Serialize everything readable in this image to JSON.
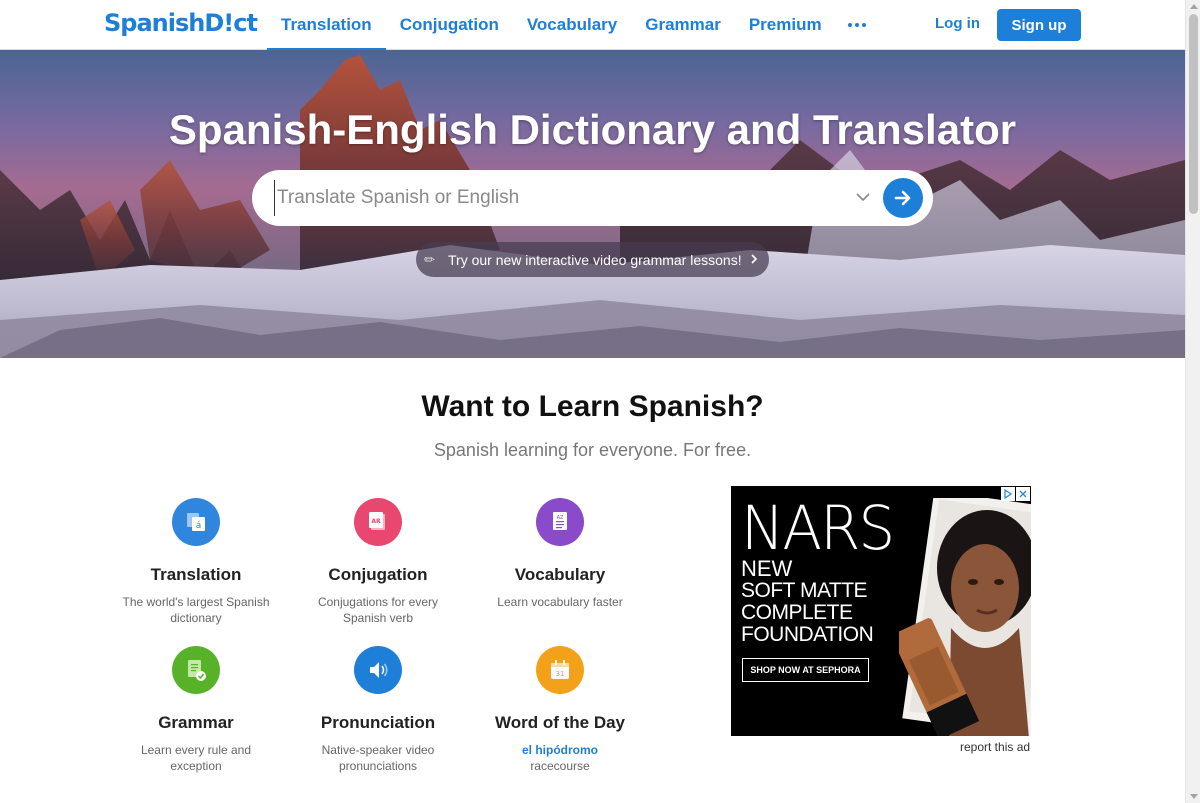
{
  "header": {
    "logo": "SpanishD!ct",
    "nav": [
      "Translation",
      "Conjugation",
      "Vocabulary",
      "Grammar",
      "Premium"
    ],
    "login": "Log in",
    "signup": "Sign up"
  },
  "hero": {
    "title": "Spanish-English Dictionary and Translator",
    "search_placeholder": "Translate Spanish or English",
    "promo": "Try our new interactive video grammar lessons!"
  },
  "learn": {
    "title": "Want to Learn Spanish?",
    "subtitle": "Spanish learning for everyone. For free.",
    "features": [
      {
        "title": "Translation",
        "desc": "The world's largest Spanish dictionary"
      },
      {
        "title": "Conjugation",
        "desc": "Conjugations for every Spanish verb"
      },
      {
        "title": "Vocabulary",
        "desc": "Learn vocabulary faster"
      },
      {
        "title": "Grammar",
        "desc": "Learn every rule and exception"
      },
      {
        "title": "Pronunciation",
        "desc": "Native-speaker video pronunciations"
      },
      {
        "title": "Word of the Day",
        "word": "el hipódromo",
        "meaning": "racecourse"
      }
    ]
  },
  "ad": {
    "brand": "NARS",
    "line1": "NEW",
    "line2": "SOFT MATTE",
    "line3": "COMPLETE",
    "line4": "FOUNDATION",
    "cta": "SHOP NOW AT SEPHORA",
    "report": "report this ad"
  },
  "colors": {
    "accent": "#1d7fd8",
    "translation_icon": "#2f86dc",
    "conjugation_icon": "#e8476f",
    "vocabulary_icon": "#8a4bcb",
    "grammar_icon": "#57b22a",
    "pronunciation_icon": "#1d7fd8",
    "word_of_day_icon": "#f4a11a"
  }
}
